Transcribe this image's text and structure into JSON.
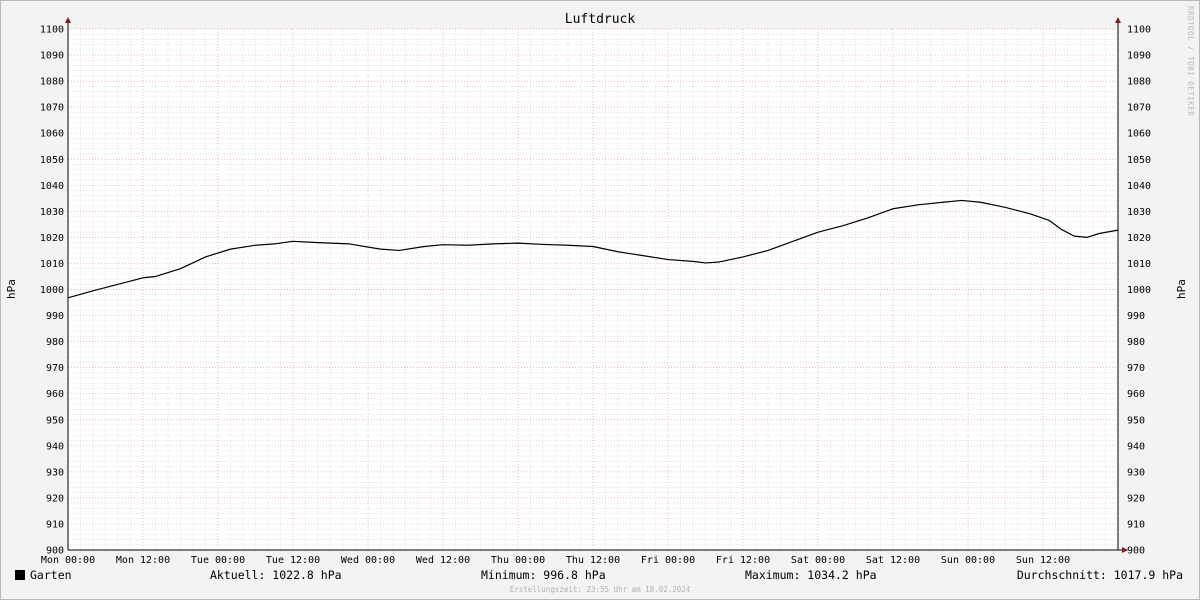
{
  "chart_data": {
    "type": "line",
    "title": "Luftdruck",
    "ylabel": "hPa",
    "ylim": [
      900,
      1100
    ],
    "yticks": [
      900,
      910,
      920,
      930,
      940,
      950,
      960,
      970,
      980,
      990,
      1000,
      1010,
      1020,
      1030,
      1040,
      1050,
      1060,
      1070,
      1080,
      1090,
      1100
    ],
    "xlim": [
      0,
      168
    ],
    "xticks": [
      {
        "hour": 0,
        "label": "Mon 00:00"
      },
      {
        "hour": 12,
        "label": "Mon 12:00"
      },
      {
        "hour": 24,
        "label": "Tue 00:00"
      },
      {
        "hour": 36,
        "label": "Tue 12:00"
      },
      {
        "hour": 48,
        "label": "Wed 00:00"
      },
      {
        "hour": 60,
        "label": "Wed 12:00"
      },
      {
        "hour": 72,
        "label": "Thu 00:00"
      },
      {
        "hour": 84,
        "label": "Thu 12:00"
      },
      {
        "hour": 96,
        "label": "Fri 00:00"
      },
      {
        "hour": 108,
        "label": "Fri 12:00"
      },
      {
        "hour": 120,
        "label": "Sat 00:00"
      },
      {
        "hour": 132,
        "label": "Sat 12:00"
      },
      {
        "hour": 144,
        "label": "Sun 00:00"
      },
      {
        "hour": 156,
        "label": "Sun 12:00"
      }
    ],
    "series": [
      {
        "name": "Garten",
        "color": "#000000",
        "points": [
          [
            0,
            996.8
          ],
          [
            4,
            999.5
          ],
          [
            8,
            1002
          ],
          [
            12,
            1004.5
          ],
          [
            14,
            1005
          ],
          [
            18,
            1008
          ],
          [
            22,
            1012.5
          ],
          [
            26,
            1015.5
          ],
          [
            30,
            1017
          ],
          [
            33,
            1017.5
          ],
          [
            36,
            1018.5
          ],
          [
            40,
            1018
          ],
          [
            45,
            1017.5
          ],
          [
            50,
            1015.5
          ],
          [
            53,
            1015
          ],
          [
            57,
            1016.5
          ],
          [
            60,
            1017.2
          ],
          [
            64,
            1017
          ],
          [
            68,
            1017.5
          ],
          [
            72,
            1017.8
          ],
          [
            76,
            1017.3
          ],
          [
            80,
            1017
          ],
          [
            84,
            1016.5
          ],
          [
            88,
            1014.5
          ],
          [
            92,
            1013
          ],
          [
            96,
            1011.5
          ],
          [
            100,
            1010.8
          ],
          [
            102,
            1010.2
          ],
          [
            104,
            1010.5
          ],
          [
            108,
            1012.5
          ],
          [
            112,
            1015
          ],
          [
            116,
            1018.5
          ],
          [
            120,
            1022
          ],
          [
            124,
            1024.5
          ],
          [
            128,
            1027.5
          ],
          [
            132,
            1031
          ],
          [
            136,
            1032.5
          ],
          [
            140,
            1033.5
          ],
          [
            143,
            1034.2
          ],
          [
            146,
            1033.5
          ],
          [
            150,
            1031.5
          ],
          [
            154,
            1029
          ],
          [
            157,
            1026.5
          ],
          [
            159,
            1023
          ],
          [
            161,
            1020.5
          ],
          [
            163,
            1020
          ],
          [
            165,
            1021.5
          ],
          [
            168,
            1022.8
          ]
        ]
      }
    ],
    "grid": true
  },
  "legend": {
    "series_name": "Garten",
    "swatch_color": "#000000"
  },
  "stats": {
    "current": "Aktuell: 1022.8 hPa",
    "minimum": "Minimum: 996.8 hPa",
    "maximum": "Maximum: 1034.2 hPa",
    "average": "Durchschnitt: 1017.9 hPa"
  },
  "footer": "Erstellungszeit: 23:55 Uhr am 18.02.2024",
  "watermark": "RRDTOOL / TOBI OETIKER",
  "colors": {
    "background": "#f3f3f3",
    "plot_area": "#ffffff",
    "major_grid": "#e8a0a0",
    "minor_grid": "#dcdcdc",
    "axis": "#000000",
    "arrow": "#8a1a1a"
  }
}
